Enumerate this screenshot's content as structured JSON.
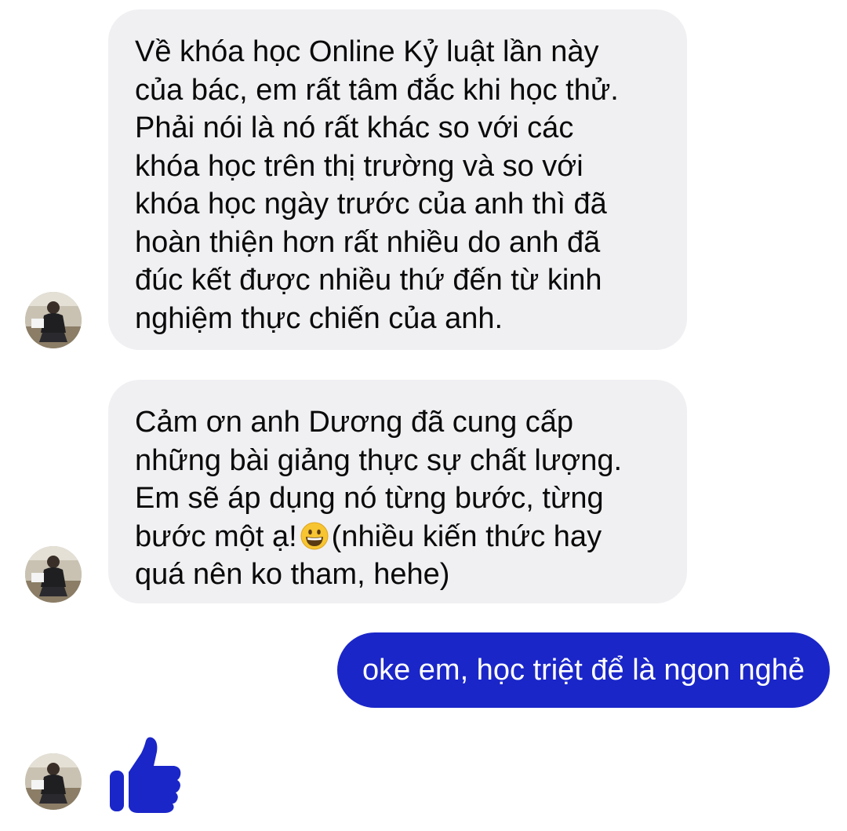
{
  "conversation": {
    "messages": [
      {
        "sender": "contact",
        "lines": [
          "Về khóa học Online Kỷ luật lần này",
          "của bác, em rất tâm đắc khi học thử.",
          "Phải nói là nó rất khác so với các",
          "khóa học trên thị trường và so với",
          "khóa học ngày trước của anh thì đã",
          "hoàn thiện hơn rất nhiều do anh đã",
          "đúc kết được nhiều thứ đến từ kinh",
          "nghiệm thực chiến của anh."
        ]
      },
      {
        "sender": "contact",
        "lines": [
          "Cảm ơn anh Dương đã cung cấp",
          "những bài giảng thực sự chất lượng.",
          "Em sẽ áp dụng nó từng bước, từng",
          "bước một ạ!",
          "(nhiều kiến thức hay",
          "quá nên ko tham, hehe)"
        ],
        "emoji": "grinning-face-emoji"
      },
      {
        "sender": "me",
        "text": "oke em, học triệt để là ngon nghẻ"
      },
      {
        "sender": "contact",
        "reaction": "thumbs-up-icon"
      }
    ]
  },
  "colors": {
    "incoming_bubble": "#f0f0f3",
    "outgoing_bubble": "#1a26c8",
    "like_icon": "#1a26c8"
  }
}
